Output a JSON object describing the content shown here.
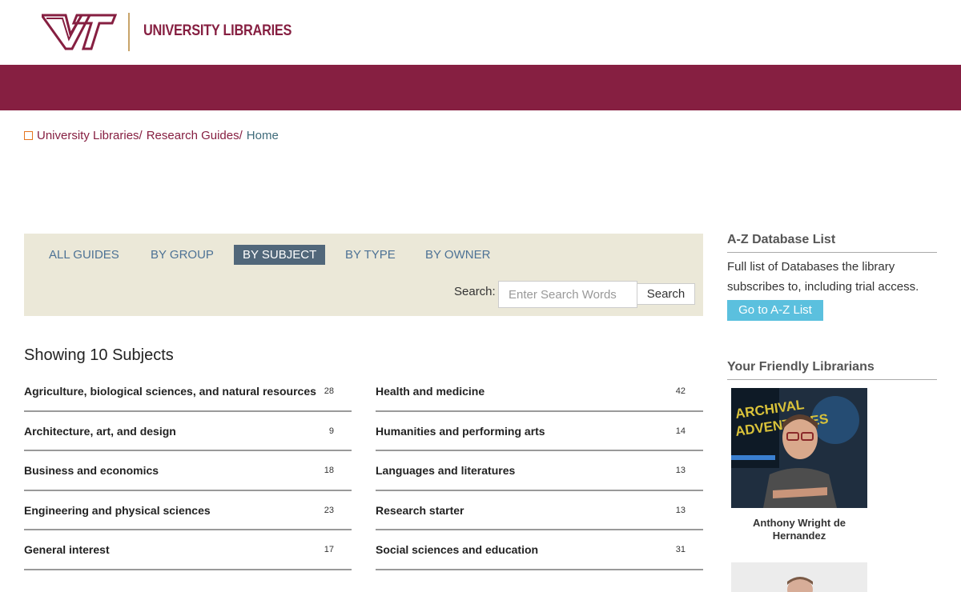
{
  "header": {
    "brand": "UNIVERSITY LIBRARIES"
  },
  "breadcrumb": {
    "items": [
      "University Libraries",
      "Research Guides",
      "Home"
    ]
  },
  "tabs": [
    {
      "label": "ALL GUIDES",
      "active": false
    },
    {
      "label": "BY GROUP",
      "active": false
    },
    {
      "label": "BY SUBJECT",
      "active": true
    },
    {
      "label": "BY TYPE",
      "active": false
    },
    {
      "label": "BY OWNER",
      "active": false
    }
  ],
  "search": {
    "label": "Search:",
    "placeholder": "Enter Search Words",
    "button": "Search"
  },
  "subjects": {
    "heading": "Showing 10 Subjects",
    "left": [
      {
        "name": "Agriculture, biological sciences, and natural resources",
        "count": "28"
      },
      {
        "name": "Architecture, art, and design",
        "count": "9"
      },
      {
        "name": "Business and economics",
        "count": "18"
      },
      {
        "name": "Engineering and physical sciences",
        "count": "23"
      },
      {
        "name": "General interest",
        "count": "17"
      }
    ],
    "right": [
      {
        "name": "Health and medicine",
        "count": "42"
      },
      {
        "name": "Humanities and performing arts",
        "count": "14"
      },
      {
        "name": "Languages and literatures",
        "count": "13"
      },
      {
        "name": "Research starter",
        "count": "13"
      },
      {
        "name": "Social sciences and education",
        "count": "31"
      }
    ]
  },
  "sidebar": {
    "az": {
      "heading": "A-Z Database List",
      "text": "Full list of Databases the library subscribes to, including trial access.",
      "button": "Go to A-Z List"
    },
    "librarians": {
      "heading": "Your Friendly Librarians",
      "first_name": "Anthony Wright de Hernandez"
    }
  },
  "colors": {
    "maroon": "#861f41",
    "accent_orange": "#e5751f",
    "panel_bg": "#ebe8d8",
    "active_tab": "#51677a",
    "az_button": "#5bc0de"
  }
}
